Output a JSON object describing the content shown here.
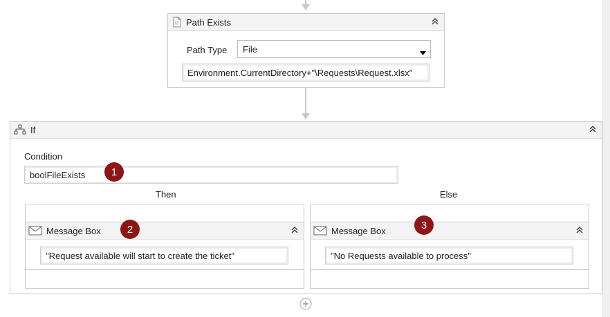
{
  "path_exists": {
    "title": "Path Exists",
    "path_type_label": "Path Type",
    "path_type_value": "File",
    "path_value": "Environment.CurrentDirectory+\"\\Requests\\Request.xlsx\""
  },
  "if_activity": {
    "title": "If",
    "condition_label": "Condition",
    "condition_value": "boolFileExists",
    "then_label": "Then",
    "else_label": "Else"
  },
  "then_message_box": {
    "title": "Message Box",
    "text_value": "\"Request available will start to create the ticket\""
  },
  "else_message_box": {
    "title": "Message Box",
    "text_value": "\"No Requests available to process\""
  },
  "badges": [
    "1",
    "2",
    "3"
  ],
  "colors": {
    "badge": "#8e1515",
    "border": "#c9c9c9",
    "header": "#f3f3f3"
  },
  "icons": {
    "path_exists": "document-icon",
    "if": "flowchart-icon",
    "message_box": "envelope-icon",
    "collapse": "double-chevron-up-icon",
    "add": "plus-circle-icon",
    "dropdown": "triangle-down-icon"
  }
}
